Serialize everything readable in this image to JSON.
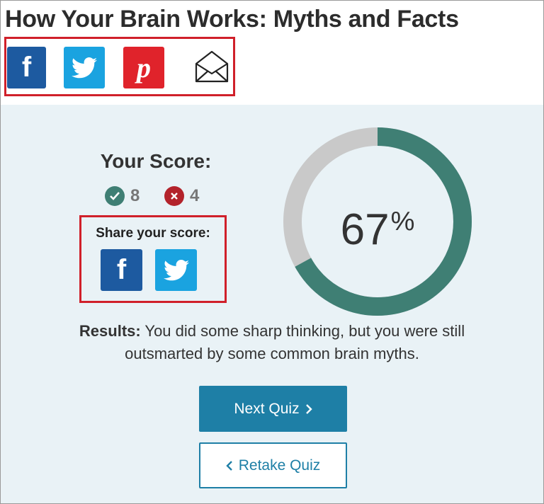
{
  "header": {
    "title": "How Your Brain Works: Myths and Facts"
  },
  "share_bar": {
    "buttons": [
      {
        "name": "facebook",
        "icon": "facebook-icon",
        "glyph": "f",
        "color": "#1d5aa0"
      },
      {
        "name": "twitter",
        "icon": "twitter-icon",
        "color": "#1aa3e0"
      },
      {
        "name": "pinterest",
        "icon": "pinterest-icon",
        "glyph": "p",
        "color": "#e0232b"
      },
      {
        "name": "email",
        "icon": "envelope-icon"
      }
    ],
    "highlight_color": "#d0202a"
  },
  "score": {
    "heading": "Your Score:",
    "correct": "8",
    "incorrect": "4",
    "correct_color": "#3f7f74",
    "incorrect_color": "#b3232b",
    "percent_value": "67",
    "percent_sign": "%",
    "fraction": 0.67,
    "ring_color": "#3f7f74",
    "ring_track_color": "#c9c9c9"
  },
  "share_score": {
    "label": "Share your score:",
    "buttons": [
      {
        "name": "facebook",
        "icon": "facebook-icon",
        "glyph": "f"
      },
      {
        "name": "twitter",
        "icon": "twitter-icon"
      }
    ]
  },
  "results": {
    "label": "Results:",
    "text": " You did some sharp thinking, but you were still outsmarted by some common brain myths."
  },
  "actions": {
    "next_label": "Next Quiz",
    "retake_label": "Retake Quiz",
    "accent": "#1e7fa6"
  }
}
